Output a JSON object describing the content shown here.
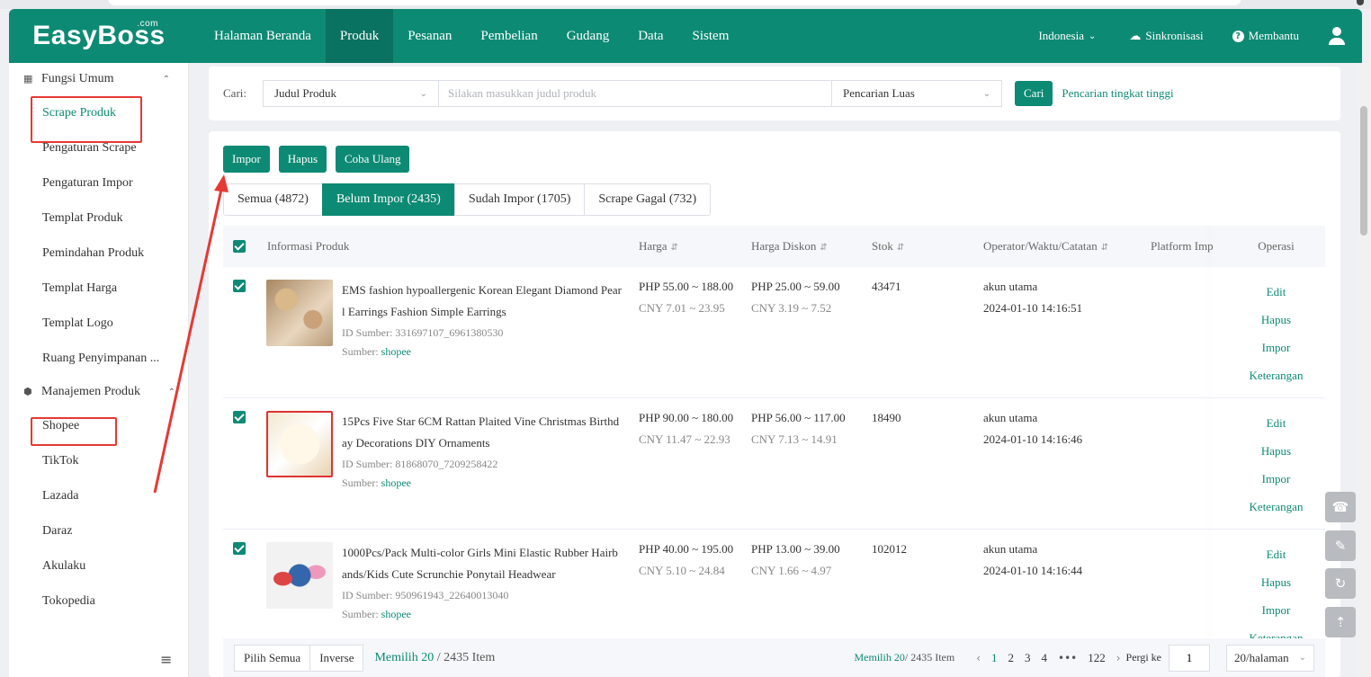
{
  "app": {
    "logo": "EasyBoss",
    "logo_sup": ".com"
  },
  "header": {
    "nav": [
      {
        "label": "Halaman Beranda",
        "active": false
      },
      {
        "label": "Produk",
        "active": true
      },
      {
        "label": "Pesanan",
        "active": false
      },
      {
        "label": "Pembelian",
        "active": false
      },
      {
        "label": "Gudang",
        "active": false
      },
      {
        "label": "Data",
        "active": false
      },
      {
        "label": "Sistem",
        "active": false
      }
    ],
    "region": "Indonesia",
    "sync": "Sinkronisasi",
    "help": "Membantu"
  },
  "sidebar": {
    "group1": "Fungsi Umum",
    "group1_items": [
      "Scrape Produk",
      "Pengaturan Scrape",
      "Pengaturan Impor",
      "Templat Produk",
      "Pemindahan Produk",
      "Templat Harga",
      "Templat Logo",
      "Ruang Penyimpanan ..."
    ],
    "group2": "Manajemen Produk",
    "group2_items": [
      "Shopee",
      "TikTok",
      "Lazada",
      "Daraz",
      "Akulaku",
      "Tokopedia"
    ]
  },
  "search": {
    "label": "Cari:",
    "field": "Judul Produk",
    "placeholder": "Silakan masukkan judul produk",
    "mode": "Pencarian Luas",
    "button": "Cari",
    "advanced": "Pencarian tingkat tinggi"
  },
  "toolbar": {
    "import": "Impor",
    "delete": "Hapus",
    "retry": "Coba Ulang"
  },
  "tabs": [
    {
      "label": "Semua (4872)",
      "active": false
    },
    {
      "label": "Belum Impor (2435)",
      "active": true
    },
    {
      "label": "Sudah Impor (1705)",
      "active": false
    },
    {
      "label": "Scrape Gagal (732)",
      "active": false
    }
  ],
  "table": {
    "columns": {
      "info": "Informasi Produk",
      "price": "Harga",
      "discount": "Harga Diskon",
      "stock": "Stok",
      "operator": "Operator/Waktu/Catatan",
      "platform": "Platform Imp",
      "ops": "Operasi"
    },
    "rows": [
      {
        "name": "EMS fashion hypoallergenic Korean Elegant Diamond Pearl Earrings Fashion Simple Earrings",
        "source_id_label": "ID Sumber:",
        "source_id": "331697107_6961380530",
        "source_label": "Sumber:",
        "source": "shopee",
        "price": "PHP 55.00 ~ 188.00",
        "price_cny": "CNY 7.01 ~ 23.95",
        "discount": "PHP 25.00 ~ 59.00",
        "discount_cny": "CNY 3.19 ~ 7.52",
        "stock": "43471",
        "operator": "akun utama",
        "time": "2024-01-10 14:16:51"
      },
      {
        "name": "15Pcs Five Star 6CM Rattan Plaited Vine Christmas Birthday Decorations DIY Ornaments",
        "source_id_label": "ID Sumber:",
        "source_id": "81868070_7209258422",
        "source_label": "Sumber:",
        "source": "shopee",
        "price": "PHP 90.00 ~ 180.00",
        "price_cny": "CNY 11.47 ~ 22.93",
        "discount": "PHP 56.00 ~ 117.00",
        "discount_cny": "CNY 7.13 ~ 14.91",
        "stock": "18490",
        "operator": "akun utama",
        "time": "2024-01-10 14:16:46"
      },
      {
        "name": "1000Pcs/Pack Multi-color Girls Mini Elastic Rubber Hairbands/Kids Cute Scrunchie Ponytail Headwear",
        "source_id_label": "ID Sumber:",
        "source_id": "950961943_22640013040",
        "source_label": "Sumber:",
        "source": "shopee",
        "price": "PHP 40.00 ~ 195.00",
        "price_cny": "CNY 5.10 ~ 24.84",
        "discount": "PHP 13.00 ~ 39.00",
        "discount_cny": "CNY 1.66 ~ 4.97",
        "stock": "102012",
        "operator": "akun utama",
        "time": "2024-01-10 14:16:44"
      }
    ],
    "ops": [
      "Edit",
      "Hapus",
      "Impor",
      "Keterangan"
    ]
  },
  "footer": {
    "select_all": "Pilih Semua",
    "inverse": "Inverse",
    "selected": "Memilih 20",
    "total": "/ 2435 Item",
    "pg_selected": "Memilih 20",
    "pg_total": "/ 2435 Item",
    "pages": [
      "1",
      "2",
      "3",
      "4",
      "122"
    ],
    "goto_label": "Pergi ke",
    "goto_value": "1",
    "page_size": "20/halaman"
  },
  "colors": {
    "primary": "#0d8a74",
    "highlight": "#e53935"
  }
}
